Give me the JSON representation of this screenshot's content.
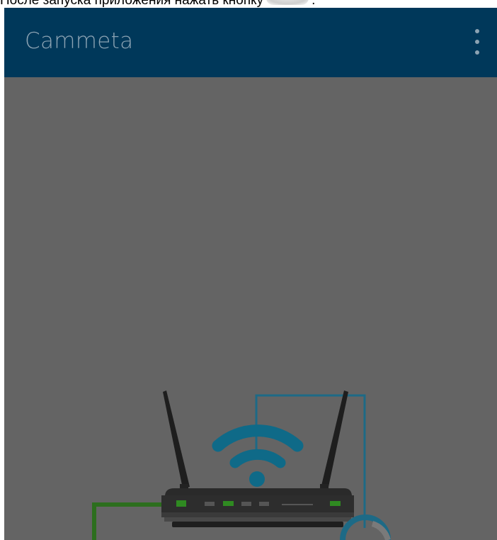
{
  "caption": {
    "text": "После запуска приложения нажать кнопку",
    "suffix": "."
  },
  "app_bar": {
    "title": "Cammeta",
    "menu_icon": "more-vertical-icon",
    "background": "#00385a",
    "title_color": "#8ca3b3"
  },
  "screen": {
    "overlay_color": "#646464"
  },
  "illustration": {
    "subject": "router-icon",
    "wifi_color": "#0f6a88",
    "cable_colors": [
      "#2c6e1e",
      "#1d6a86"
    ]
  }
}
